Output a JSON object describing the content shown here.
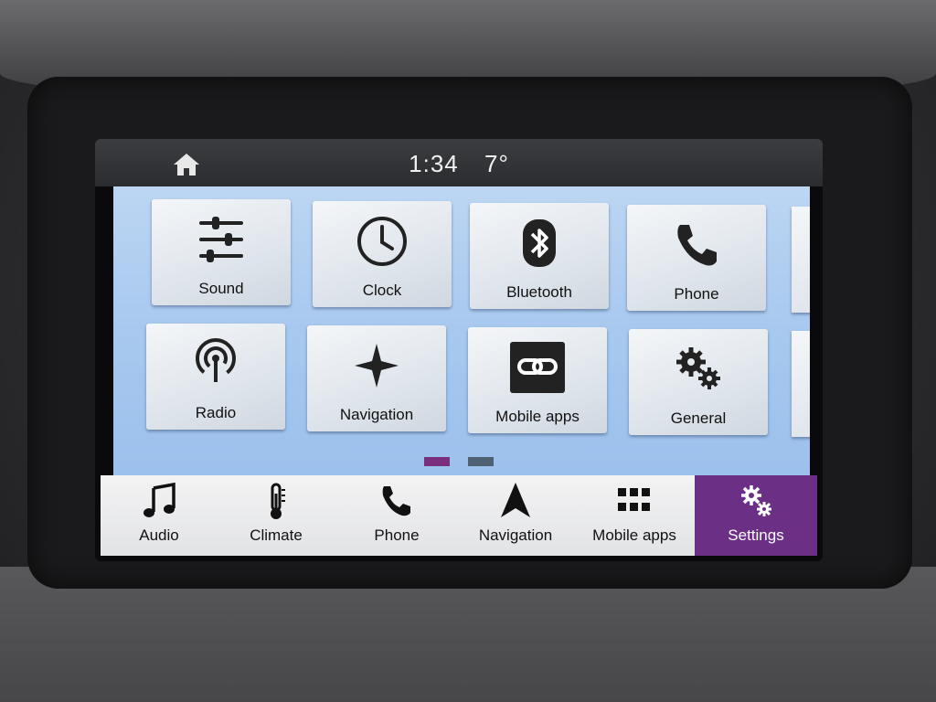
{
  "status_bar": {
    "time": "1:34",
    "temperature": "7°",
    "home_icon": "home-icon"
  },
  "settings_grid": {
    "tiles": [
      {
        "label": "Sound",
        "icon": "equalizer-icon"
      },
      {
        "label": "Clock",
        "icon": "clock-icon"
      },
      {
        "label": "Bluetooth",
        "icon": "bluetooth-icon"
      },
      {
        "label": "Phone",
        "icon": "phone-icon"
      },
      {
        "label": "Radio",
        "icon": "radio-icon"
      },
      {
        "label": "Navigation",
        "icon": "compass-star-icon"
      },
      {
        "label": "Mobile apps",
        "icon": "link-icon"
      },
      {
        "label": "General",
        "icon": "gears-icon"
      }
    ],
    "pages": [
      {
        "active": true
      },
      {
        "active": false
      }
    ]
  },
  "bottom_nav": {
    "items": [
      {
        "label": "Audio",
        "icon": "music-note-icon"
      },
      {
        "label": "Climate",
        "icon": "thermometer-icon"
      },
      {
        "label": "Phone",
        "icon": "phone-icon"
      },
      {
        "label": "Navigation",
        "icon": "navigation-arrow-icon"
      },
      {
        "label": "Mobile apps",
        "icon": "app-grid-icon"
      },
      {
        "label": "Settings",
        "icon": "gears-icon",
        "active": true
      }
    ]
  },
  "colors": {
    "accent": "#6b2f86",
    "page_indicator_active": "#7a2f7e",
    "page_indicator_inactive": "#4f6073",
    "content_background": "#a9c9ef"
  }
}
